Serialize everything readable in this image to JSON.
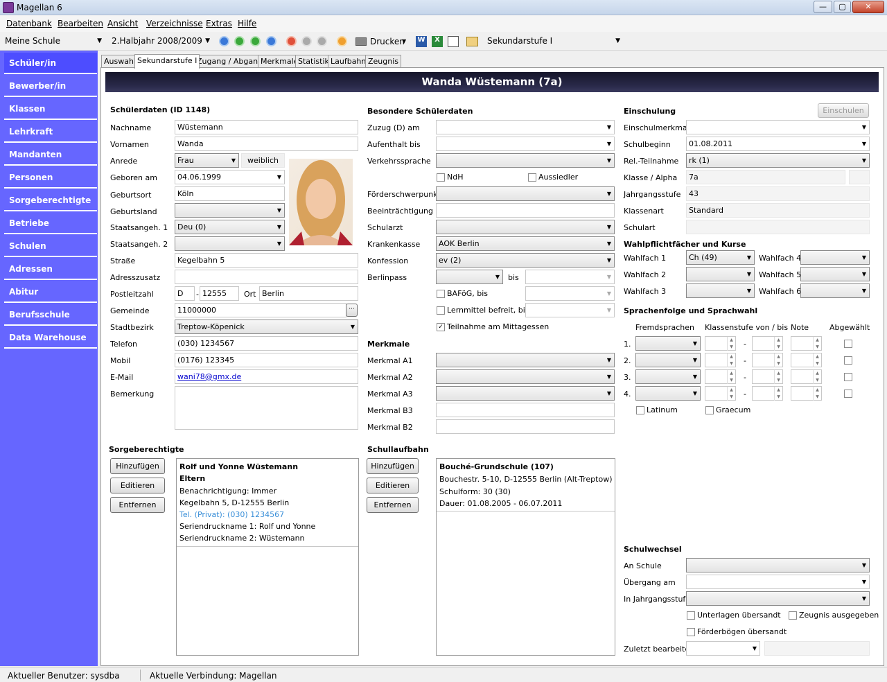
{
  "window": {
    "title": "Magellan 6",
    "min": "—",
    "max": "▢",
    "close": "✕"
  },
  "menu": [
    "Datenbank",
    "Bearbeiten",
    "Ansicht",
    "Verzeichnisse",
    "Extras",
    "Hilfe"
  ],
  "toolbar": {
    "school": "Meine Schule",
    "period": "2.Halbjahr 2008/2009",
    "print": "Drucken",
    "level": "Sekundarstufe I"
  },
  "nav": [
    "Schüler/in",
    "Bewerber/in",
    "Klassen",
    "Lehrkraft",
    "Mandanten",
    "Personen",
    "Sorgeberechtigte",
    "Betriebe",
    "Schulen",
    "Adressen",
    "Abitur",
    "Berufsschule",
    "Data Warehouse"
  ],
  "tabs": [
    "Auswahl",
    "Sekundarstufe I",
    "Zugang / Abgang",
    "Merkmale",
    "Statistik",
    "Laufbahn",
    "Zeugnis"
  ],
  "header": "Wanda Wüstemann (7a)",
  "student": {
    "section": "Schülerdaten (ID 1148)",
    "labels": {
      "nachname": "Nachname",
      "vornamen": "Vornamen",
      "anrede": "Anrede",
      "geboren": "Geboren am",
      "geburtsort": "Geburtsort",
      "geburtsland": "Geburtsland",
      "sa1": "Staatsangeh. 1",
      "sa2": "Staatsangeh. 2",
      "strasse": "Straße",
      "adresszusatz": "Adresszusatz",
      "plz": "Postleitzahl",
      "ort": "Ort",
      "gemeinde": "Gemeinde",
      "stadtbezirk": "Stadtbezirk",
      "telefon": "Telefon",
      "mobil": "Mobil",
      "email": "E-Mail",
      "bemerkung": "Bemerkung"
    },
    "values": {
      "nachname": "Wüstemann",
      "vornamen": "Wanda",
      "anrede": "Frau",
      "geschlecht": "weiblich",
      "geboren": "04.06.1999",
      "geburtsort": "Köln",
      "sa1": "Deu (0)",
      "strasse": "Kegelbahn 5",
      "plz_land": "D",
      "plz": "12555",
      "ort": "Berlin",
      "gemeinde": "11000000",
      "stadtbezirk": "Treptow-Köpenick",
      "telefon": "(030) 1234567",
      "mobil": "(0176) 123345",
      "email": "wani78@gmx.de"
    }
  },
  "besondere": {
    "section": "Besondere Schülerdaten",
    "labels": {
      "zuzug": "Zuzug (D) am",
      "aufenthalt": "Aufenthalt bis",
      "verkehrssprache": "Verkehrssprache",
      "ndh": "NdH",
      "aussiedler": "Aussiedler",
      "foerder": "Förderschwerpunkt",
      "beeintr": "Beeinträchtigung",
      "schularzt": "Schularzt",
      "kk": "Krankenkasse",
      "konfession": "Konfession",
      "berlinpass": "Berlinpass",
      "bis": "bis",
      "bafoeg": "BAFöG, bis",
      "lernmittel": "Lernmittel befreit, bis",
      "mittag": "Teilnahme am Mittagessen"
    },
    "values": {
      "kk": "AOK Berlin",
      "konfession": "ev (2)"
    }
  },
  "merkmale": {
    "section": "Merkmale",
    "labels": [
      "Merkmal A1",
      "Merkmal A2",
      "Merkmal A3",
      "Merkmal B3",
      "Merkmal B2"
    ]
  },
  "einschulung": {
    "section": "Einschulung",
    "button": "Einschulen",
    "labels": {
      "merkmal": "Einschulmerkmal",
      "beginn": "Schulbeginn",
      "rel": "Rel.-Teilnahme",
      "klasse": "Klasse / Alpha",
      "jgst": "Jahrgangsstufe",
      "klassenart": "Klassenart",
      "schulart": "Schulart"
    },
    "values": {
      "beginn": "01.08.2011",
      "rel": "rk (1)",
      "klasse": "7a",
      "jgst": "43",
      "klassenart": "Standard"
    }
  },
  "wahlpflicht": {
    "section": "Wahlpflichtfächer und Kurse",
    "labels": [
      "Wahlfach 1",
      "Wahlfach 2",
      "Wahlfach 3",
      "Wahlfach 4",
      "Wahlfach 5",
      "Wahlfach 6"
    ],
    "wf1": "Ch (49)"
  },
  "sprachen": {
    "section": "Sprachenfolge und Sprachwahl",
    "col_fremd": "Fremdsprachen",
    "col_stufe": "Klassenstufe von / bis",
    "col_note": "Note",
    "col_abg": "Abgewählt",
    "rows": [
      "1.",
      "2.",
      "3.",
      "4."
    ],
    "dash": "-",
    "latinum": "Latinum",
    "graecum": "Graecum"
  },
  "schulwechsel": {
    "section": "Schulwechsel",
    "labels": {
      "an": "An Schule",
      "uebergang": "Übergang am",
      "jgst": "In Jahrgangsstufe",
      "unterlagen": "Unterlagen übersandt",
      "zeugnis": "Zeugnis ausgegeben",
      "foerderboegen": "Förderbögen übersandt",
      "zuletzt": "Zuletzt bearbeitet"
    }
  },
  "sorge": {
    "section": "Sorgeberechtigte",
    "buttons": [
      "Hinzufügen",
      "Editieren",
      "Entfernen"
    ],
    "card": {
      "name": "Rolf und Yonne Wüstemann",
      "role": "Eltern",
      "benach": "Benachrichtigung: Immer",
      "addr": "Kegelbahn 5, D-12555 Berlin",
      "tel": "Tel. (Privat): (030) 1234567",
      "sdn1": "Seriendruckname 1: Rolf und Yonne",
      "sdn2": "Seriendruckname 2: Wüstemann"
    }
  },
  "laufbahn": {
    "section": "Schullaufbahn",
    "buttons": [
      "Hinzufügen",
      "Editieren",
      "Entfernen"
    ],
    "card": {
      "name": "Bouché-Grundschule (107)",
      "addr": "Bouchestr. 5-10, D-12555 Berlin (Alt-Treptow)",
      "form": "Schulform: 30 (30)",
      "dauer": "Dauer: 01.08.2005 - 06.07.2011"
    }
  },
  "status": {
    "user": "Aktueller Benutzer: sysdba",
    "conn": "Aktuelle Verbindung: Magellan"
  },
  "colors": {
    "sidebar": "#6666ff",
    "header": "#1e1e3a",
    "link": "#0000cc",
    "tel_blue": "#3a8fd8"
  }
}
